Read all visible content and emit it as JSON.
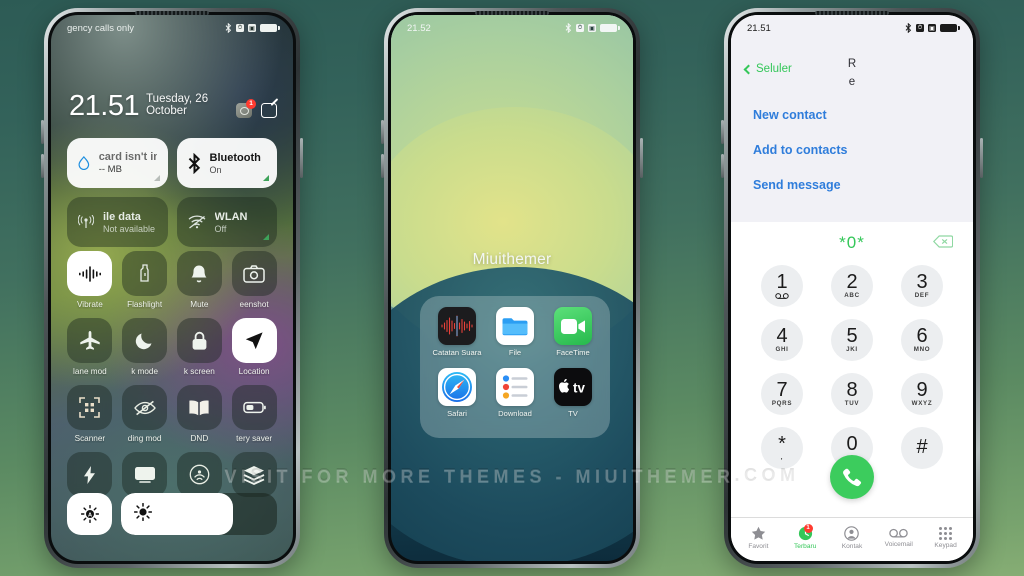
{
  "watermark": "VISIT  FOR  MORE  THEMES  -  MIUITHEMER.COM",
  "colors": {
    "accent_green": "#34c759",
    "link_blue": "#2f7ddb",
    "badge_red": "#ff3b30",
    "tile_on_bg": "#ffffff"
  },
  "left_phone": {
    "status": {
      "carrier": "gency calls only",
      "bluetooth": "bluetooth-icon",
      "alarm": "alarm-icon",
      "battery": "battery-full-icon"
    },
    "time": "21.51",
    "date": "Tuesday, 26 October",
    "header_icons": {
      "camera": "camera-icon",
      "camera_badge": "1",
      "edit": "edit-icon"
    },
    "big_tiles": [
      {
        "title": "card isn't inst.",
        "sub": "-- MB",
        "icon": "data-drop-icon",
        "state": "on"
      },
      {
        "title": "Bluetooth",
        "sub": "On",
        "icon": "bluetooth-icon",
        "state": "on"
      },
      {
        "title": "ile data",
        "sub": "Not available",
        "icon": "cellular-icon",
        "state": "off"
      },
      {
        "title": "WLAN",
        "sub": "Off",
        "icon": "wifi-off-icon",
        "state": "off"
      }
    ],
    "toggles": [
      {
        "label": "Vibrate",
        "icon": "vibrate-icon",
        "state": "on"
      },
      {
        "label": "Flashlight",
        "icon": "flashlight-icon",
        "state": "off"
      },
      {
        "label": "Mute",
        "icon": "bell-icon",
        "state": "off"
      },
      {
        "label": "eenshot",
        "icon": "camera-icon",
        "state": "off"
      },
      {
        "label": "lane mod",
        "icon": "airplane-icon",
        "state": "off"
      },
      {
        "label": "k mode",
        "icon": "moon-icon",
        "state": "off"
      },
      {
        "label": "k screen",
        "icon": "lock-icon",
        "state": "off"
      },
      {
        "label": "Location",
        "icon": "location-icon",
        "state": "on"
      },
      {
        "label": "Scanner",
        "icon": "qr-scanner-icon",
        "state": "off"
      },
      {
        "label": "ding mod",
        "icon": "eye-off-icon",
        "state": "off"
      },
      {
        "label": "DND",
        "icon": "book-icon",
        "state": "off"
      },
      {
        "label": "tery saver",
        "icon": "battery-saver-icon",
        "state": "off"
      },
      {
        "label": "",
        "icon": "bolt-icon",
        "state": "off"
      },
      {
        "label": "",
        "icon": "cast-icon",
        "state": "off"
      },
      {
        "label": "",
        "icon": "airdrop-icon",
        "state": "off"
      },
      {
        "label": "",
        "icon": "layers-icon",
        "state": "off"
      }
    ],
    "brightness": {
      "auto_icon": "brightness-auto-icon",
      "slider_icon": "brightness-icon",
      "level_percent": 72
    }
  },
  "mid_phone": {
    "status": {
      "time": "21.52",
      "bluetooth": "bluetooth-icon",
      "alarm": "alarm-icon",
      "battery": "battery-full-icon"
    },
    "folder_name": "Miuithemer",
    "apps": [
      {
        "label": "Catatan Suara",
        "icon": "voice-memos-icon"
      },
      {
        "label": "File",
        "icon": "files-icon"
      },
      {
        "label": "FaceTime",
        "icon": "facetime-icon"
      },
      {
        "label": "Safari",
        "icon": "safari-icon"
      },
      {
        "label": "Download",
        "icon": "reminders-icon"
      },
      {
        "label": "TV",
        "icon": "apple-tv-icon"
      }
    ]
  },
  "right_phone": {
    "status": {
      "time": "21.51",
      "bluetooth": "bluetooth-icon",
      "alarm": "alarm-icon",
      "battery": "battery-full-icon"
    },
    "back_label": "Seluler",
    "caller_line1": "R",
    "caller_line2": "e",
    "actions": [
      "New contact",
      "Add to contacts",
      "Send message"
    ],
    "entered_number": "*0*",
    "backspace_icon": "backspace-icon",
    "keys": [
      {
        "digit": "1",
        "sub": "",
        "icon": "voicemail-icon"
      },
      {
        "digit": "2",
        "sub": "ABC",
        "icon": ""
      },
      {
        "digit": "3",
        "sub": "DEF",
        "icon": ""
      },
      {
        "digit": "4",
        "sub": "GHI",
        "icon": ""
      },
      {
        "digit": "5",
        "sub": "JKI",
        "icon": ""
      },
      {
        "digit": "6",
        "sub": "MNO",
        "icon": ""
      },
      {
        "digit": "7",
        "sub": "PQRS",
        "icon": ""
      },
      {
        "digit": "8",
        "sub": "TUV",
        "icon": ""
      },
      {
        "digit": "9",
        "sub": "WXYZ",
        "icon": ""
      },
      {
        "digit": "*",
        "sub": ",",
        "icon": ""
      },
      {
        "digit": "0",
        "sub": "+",
        "icon": ""
      },
      {
        "digit": "#",
        "sub": "",
        "icon": ""
      }
    ],
    "call_button_icon": "phone-icon",
    "tabs": [
      {
        "label": "Favorit",
        "icon": "star-icon",
        "active": false,
        "badge": ""
      },
      {
        "label": "Terbaru",
        "icon": "recents-icon",
        "active": true,
        "badge": "1"
      },
      {
        "label": "Kontak",
        "icon": "contacts-icon",
        "active": false,
        "badge": ""
      },
      {
        "label": "Voicemail",
        "icon": "voicemail-icon",
        "active": false,
        "badge": ""
      },
      {
        "label": "Keypad",
        "icon": "keypad-icon",
        "active": false,
        "badge": ""
      }
    ]
  }
}
